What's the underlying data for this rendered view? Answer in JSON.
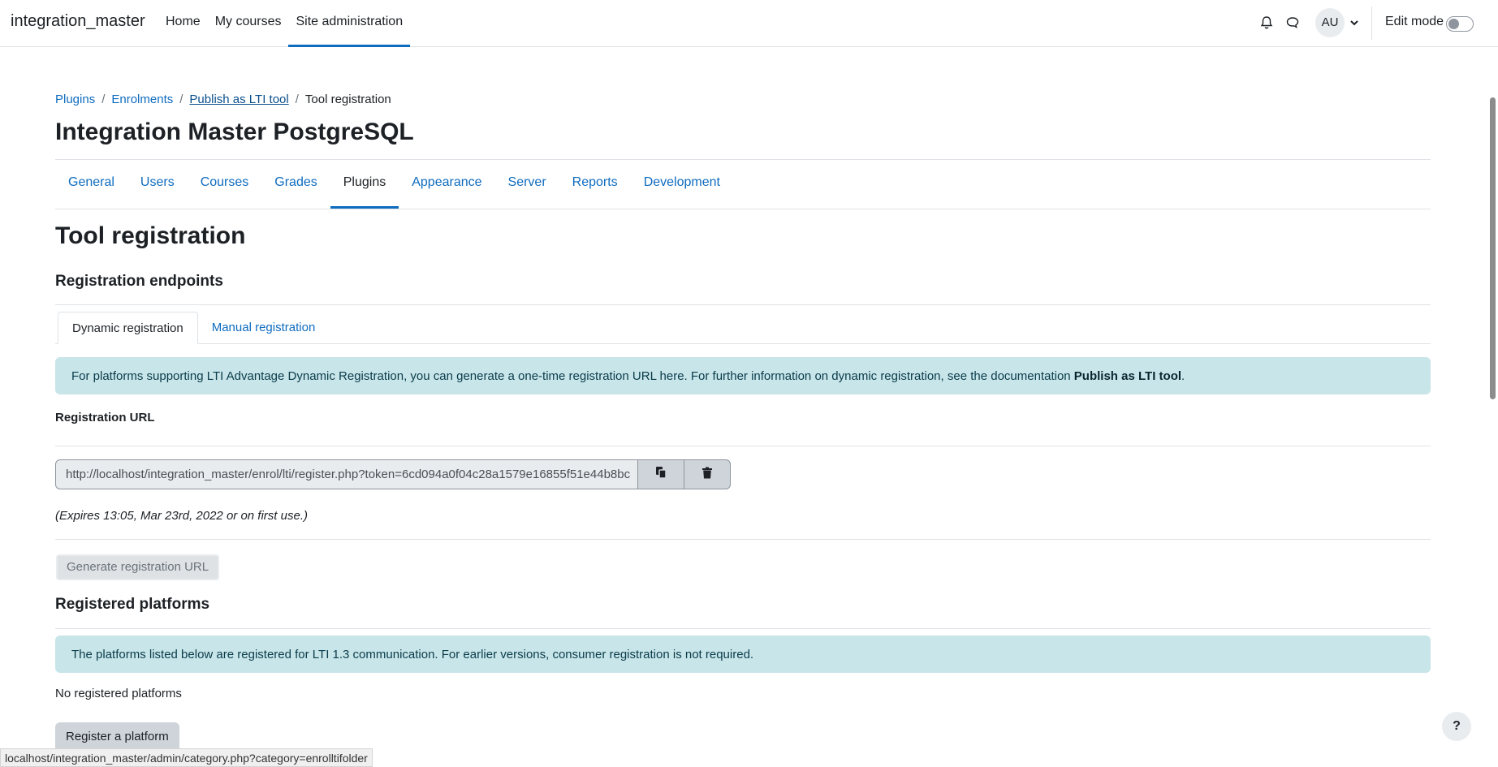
{
  "navbar": {
    "brand": "integration_master",
    "links": [
      "Home",
      "My courses",
      "Site administration"
    ],
    "active_link": "Site administration",
    "user_initials": "AU",
    "edit_mode_label": "Edit mode",
    "edit_mode_on": false
  },
  "breadcrumb": [
    "Plugins",
    "Enrolments",
    "Publish as LTI tool",
    "Tool registration"
  ],
  "page_title": "Integration Master PostgreSQL",
  "secondary_tabs": [
    "General",
    "Users",
    "Courses",
    "Grades",
    "Plugins",
    "Appearance",
    "Server",
    "Reports",
    "Development"
  ],
  "active_secondary_tab": "Plugins",
  "main": {
    "heading": "Tool registration",
    "endpoints_heading": "Registration endpoints",
    "subtabs": [
      "Dynamic registration",
      "Manual registration"
    ],
    "active_subtab": "Dynamic registration",
    "info_text": "For platforms supporting LTI Advantage Dynamic Registration, you can generate a one-time registration URL here. For further information on dynamic registration, see the documentation ",
    "info_link": "Publish as LTI tool",
    "info_end": ".",
    "registration_url_label": "Registration URL",
    "registration_url_value": "http://localhost/integration_master/enrol/lti/register.php?token=6cd094a0f04c28a1579e16855f51e44b8bc",
    "expires": "(Expires 13:05, Mar 23rd, 2022 or on first use.)",
    "generate_button": "Generate registration URL",
    "platforms_heading": "Registered platforms",
    "platforms_info": "The platforms listed below are registered for LTI 1.3 communication. For earlier versions, consumer registration is not required.",
    "no_platforms": "No registered platforms",
    "register_button": "Register a platform"
  },
  "status_bar_url": "localhost/integration_master/admin/category.php?category=enrolltifolder",
  "help_label": "?",
  "icons": [
    "bell-icon",
    "chat-icon",
    "chevron-down-icon",
    "copy-icon",
    "trash-icon"
  ],
  "colors": {
    "link": "#0f6cbf",
    "alert_bg": "#c8e5e9",
    "active_underline": "#0f6cbf"
  }
}
